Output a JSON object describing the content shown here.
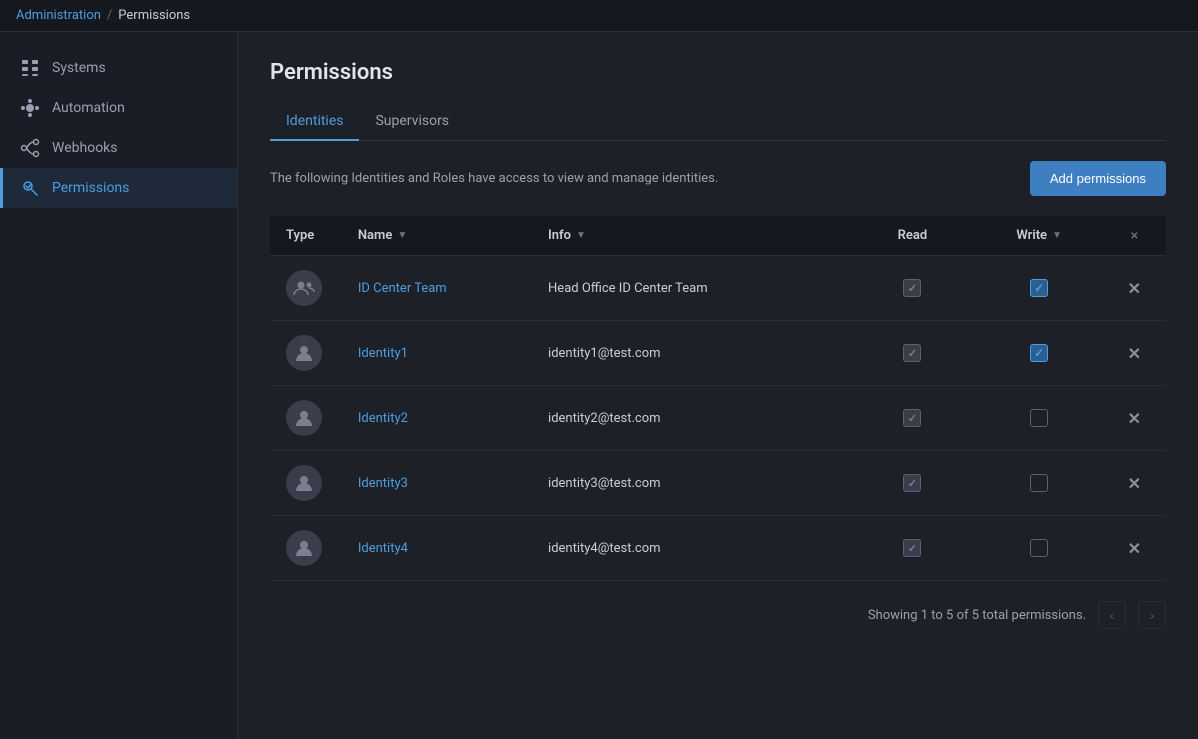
{
  "topbar": {
    "admin_link": "Administration",
    "separator": "/",
    "current": "Permissions"
  },
  "sidebar": {
    "items": [
      {
        "id": "systems",
        "label": "Systems",
        "icon": "▦"
      },
      {
        "id": "automation",
        "label": "Automation",
        "icon": "🤖"
      },
      {
        "id": "webhooks",
        "label": "Webhooks",
        "icon": "⚙"
      },
      {
        "id": "permissions",
        "label": "Permissions",
        "icon": "🔑",
        "active": true
      }
    ]
  },
  "page": {
    "title": "Permissions",
    "tabs": [
      {
        "id": "identities",
        "label": "Identities",
        "active": true
      },
      {
        "id": "supervisors",
        "label": "Supervisors",
        "active": false
      }
    ],
    "description": "The following Identities and Roles have access to view and manage identities.",
    "add_button_label": "Add permissions"
  },
  "table": {
    "columns": [
      {
        "id": "type",
        "label": "Type"
      },
      {
        "id": "name",
        "label": "Name"
      },
      {
        "id": "info",
        "label": "Info"
      },
      {
        "id": "read",
        "label": "Read"
      },
      {
        "id": "write",
        "label": "Write"
      },
      {
        "id": "action",
        "label": ""
      }
    ],
    "rows": [
      {
        "id": 1,
        "type": "group",
        "name": "ID Center Team",
        "info": "Head Office ID Center Team",
        "read": true,
        "read_checked": true,
        "write": true,
        "write_checked": true
      },
      {
        "id": 2,
        "type": "user",
        "name": "Identity1",
        "info": "identity1@test.com",
        "read": true,
        "read_checked": true,
        "write": true,
        "write_checked": true
      },
      {
        "id": 3,
        "type": "user",
        "name": "Identity2",
        "info": "identity2@test.com",
        "read": true,
        "read_checked": true,
        "write": false,
        "write_checked": false
      },
      {
        "id": 4,
        "type": "user",
        "name": "Identity3",
        "info": "identity3@test.com",
        "read": true,
        "read_checked": true,
        "write": false,
        "write_checked": false
      },
      {
        "id": 5,
        "type": "user",
        "name": "Identity4",
        "info": "identity4@test.com",
        "read": true,
        "read_checked": true,
        "write": false,
        "write_checked": false
      }
    ]
  },
  "pagination": {
    "status": "Showing 1 to 5 of 5 total permissions.",
    "prev_disabled": true,
    "next_disabled": true
  },
  "icons": {
    "group": "👥",
    "user": "👤",
    "filter": "▼",
    "delete": "✕",
    "prev": "‹",
    "next": "›"
  }
}
